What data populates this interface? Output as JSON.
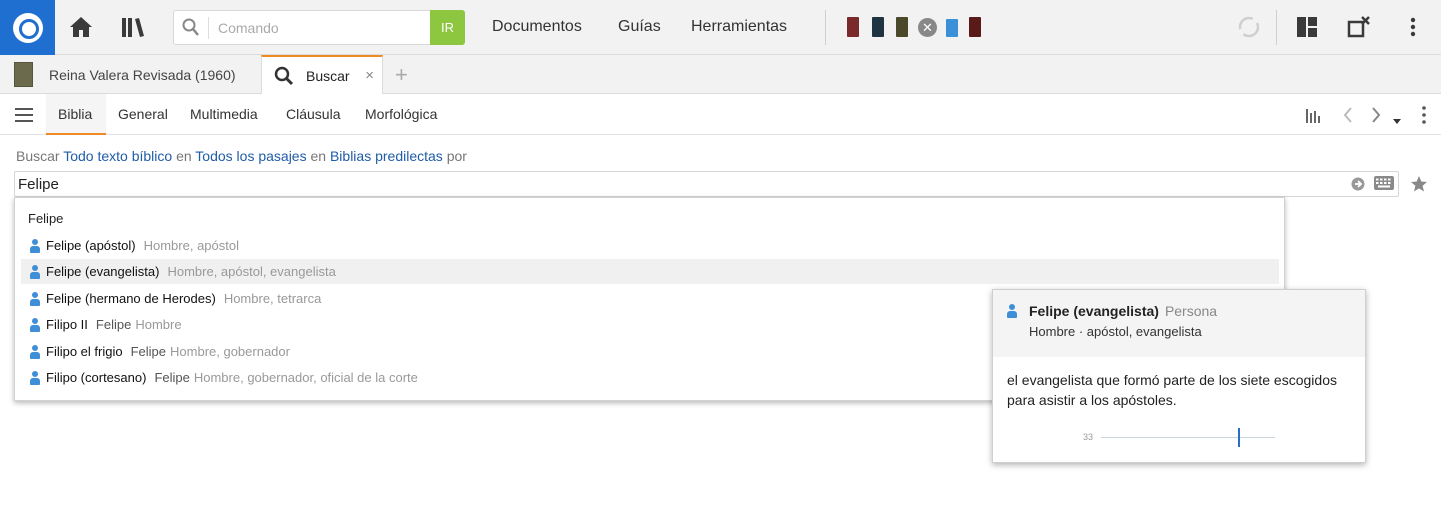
{
  "colors": {
    "brand": "#1e6fd0",
    "go": "#8dc63f",
    "accent": "#f08a24",
    "link": "#1f5ca8",
    "person": "#3f8fd8"
  },
  "topbar": {
    "command": {
      "placeholder": "Comando",
      "go_label": "IR"
    },
    "nav": [
      "Documentos",
      "Guías",
      "Herramientas"
    ],
    "icons": [
      "home-icon",
      "library-icon",
      "search-icon",
      "sync-icon",
      "layout-icon",
      "close-window-icon",
      "more-icon"
    ]
  },
  "tabs": [
    {
      "label": "Reina Valera Revisada (1960)"
    },
    {
      "label": "Buscar",
      "close": "×"
    }
  ],
  "add_tab": "+",
  "search_tabs": [
    "Biblia",
    "General",
    "Multimedia",
    "Cláusula",
    "Morfológica"
  ],
  "query": {
    "prefix": "Buscar",
    "scope": "Todo texto bíblico",
    "in1": "en",
    "range": "Todos los pasajes",
    "in2": "en",
    "bibles": "Biblias predilectas",
    "by": "por",
    "value": "Felipe"
  },
  "dropdown": {
    "header": "Felipe",
    "items": [
      {
        "name": "Felipe (apóstol)",
        "alt": "",
        "desc": "Hombre, apóstol"
      },
      {
        "name": "Felipe (evangelista)",
        "alt": "",
        "desc": "Hombre, apóstol, evangelista"
      },
      {
        "name": "Felipe (hermano de Herodes)",
        "alt": "",
        "desc": "Hombre, tetrarca"
      },
      {
        "name": "Filipo II",
        "alt": "Felipe",
        "desc": "Hombre"
      },
      {
        "name": "Filipo el frigio",
        "alt": "Felipe",
        "desc": "Hombre, gobernador"
      },
      {
        "name": "Filipo (cortesano)",
        "alt": "Felipe",
        "desc": "Hombre, gobernador, oficial de la corte"
      }
    ]
  },
  "popup": {
    "title": "Felipe (evangelista)",
    "type": "Persona",
    "subtitle": "Hombre · apóstol, evangelista",
    "body": "el evangelista que formó parte de los siete escogidos para asistir a los apóstoles.",
    "count": "33"
  }
}
